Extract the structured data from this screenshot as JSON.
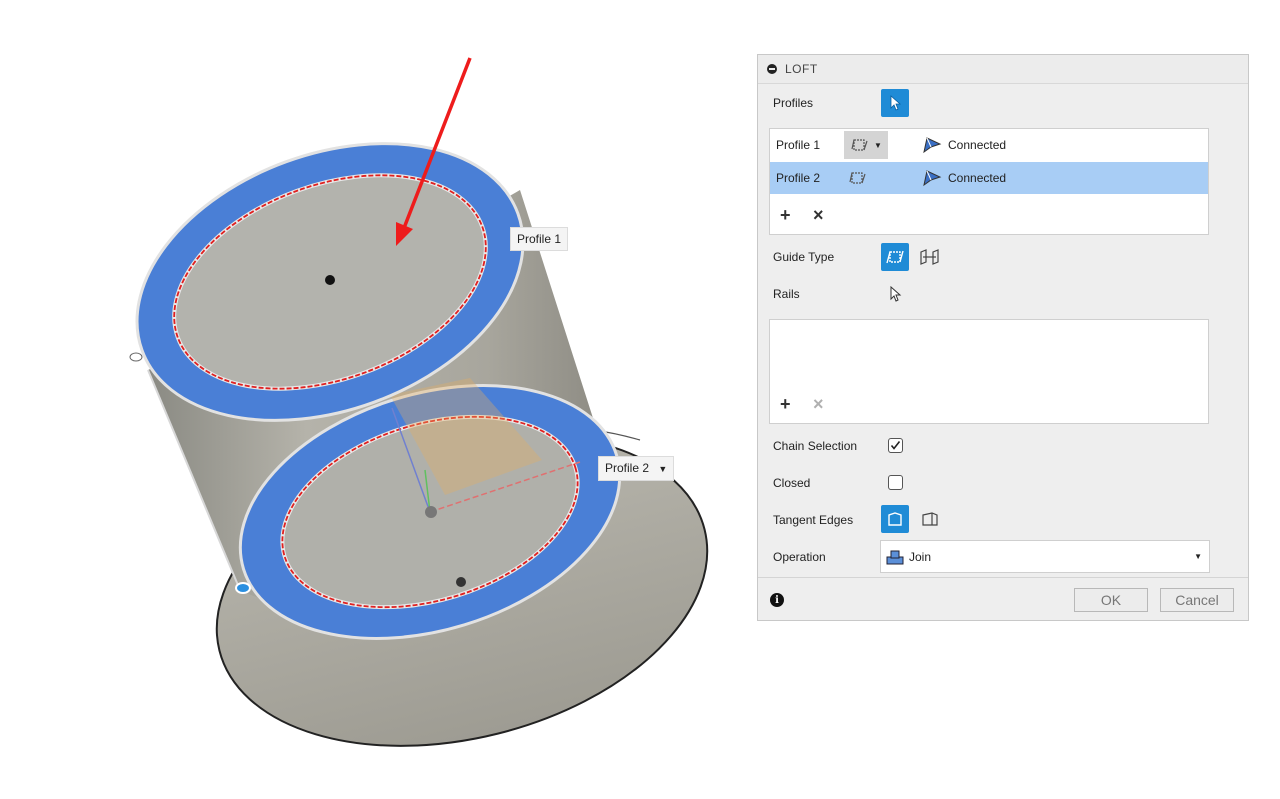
{
  "viewport": {
    "profile1_label": "Profile 1",
    "profile2_label": "Profile 2",
    "profile2_dropdown": "▼"
  },
  "panel": {
    "title": "LOFT",
    "profiles_label": "Profiles",
    "profiles_list": [
      {
        "name": "Profile 1",
        "status": "Connected",
        "has_dropdown": true,
        "selected": false
      },
      {
        "name": "Profile 2",
        "status": "Connected",
        "has_dropdown": false,
        "selected": true
      }
    ],
    "add_symbol": "+",
    "remove_symbol": "×",
    "guide_type_label": "Guide Type",
    "rails_label": "Rails",
    "chain_selection_label": "Chain Selection",
    "chain_selection_checked": true,
    "closed_label": "Closed",
    "closed_checked": false,
    "tangent_edges_label": "Tangent Edges",
    "operation_label": "Operation",
    "operation_value": "Join",
    "ok_label": "OK",
    "cancel_label": "Cancel",
    "info_icon": "i"
  },
  "colors": {
    "accent": "#1f8bd6",
    "selected_row": "#a8cdf5",
    "profile_face": "#4a7fd6",
    "arrow": "#ee1c1c"
  }
}
